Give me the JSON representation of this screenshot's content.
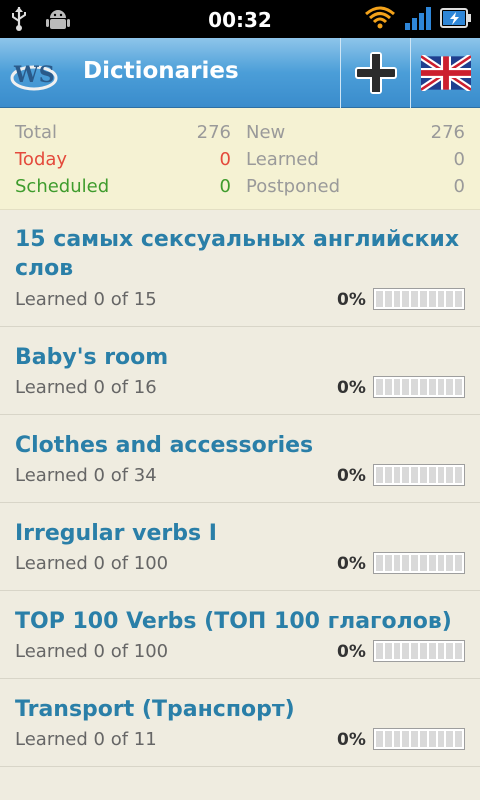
{
  "status_bar": {
    "time": "00:32",
    "icons": [
      "usb-icon",
      "android-debug-icon",
      "wifi-icon",
      "signal-icon",
      "battery-charging-icon"
    ]
  },
  "app_bar": {
    "title": "Dictionaries",
    "logo": "ws-logo",
    "add_icon": "plus-icon",
    "language_icon": "uk-flag-icon"
  },
  "stats": {
    "total": {
      "label": "Total",
      "value": "276"
    },
    "today": {
      "label": "Today",
      "value": "0"
    },
    "scheduled": {
      "label": "Scheduled",
      "value": "0"
    },
    "new": {
      "label": "New",
      "value": "276"
    },
    "learned": {
      "label": "Learned",
      "value": "0"
    },
    "postponed": {
      "label": "Postponed",
      "value": "0"
    }
  },
  "dictionaries": [
    {
      "title": "15 самых сексуальных английских слов",
      "subtitle": "Learned 0 of 15",
      "percent": "0%",
      "progress": 0
    },
    {
      "title": "Baby's room",
      "subtitle": "Learned 0 of 16",
      "percent": "0%",
      "progress": 0
    },
    {
      "title": "Clothes and accessories",
      "subtitle": "Learned 0 of 34",
      "percent": "0%",
      "progress": 0
    },
    {
      "title": "Irregular verbs I",
      "subtitle": "Learned 0 of 100",
      "percent": "0%",
      "progress": 0
    },
    {
      "title": "TOP 100 Verbs (ТОП 100 глаголов)",
      "subtitle": "Learned 0 of 100",
      "percent": "0%",
      "progress": 0
    },
    {
      "title": "Transport (Транспорт)",
      "subtitle": "Learned 0 of 11",
      "percent": "0%",
      "progress": 0
    }
  ],
  "colors": {
    "title_blue": "#2a7fa8",
    "today_red": "#e44a3c",
    "scheduled_green": "#3f9c2d",
    "appbar_blue": "#4b9ed8"
  }
}
